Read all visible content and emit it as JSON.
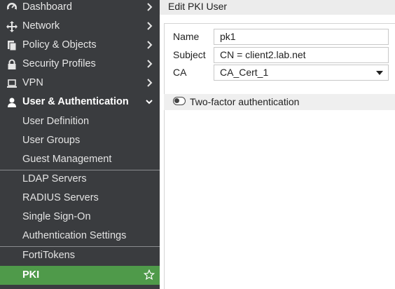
{
  "sidebar": {
    "items": [
      {
        "label": "Dashboard",
        "icon": "dashboard-icon"
      },
      {
        "label": "Network",
        "icon": "network-icon"
      },
      {
        "label": "Policy & Objects",
        "icon": "policy-icon"
      },
      {
        "label": "Security Profiles",
        "icon": "lock-icon"
      },
      {
        "label": "VPN",
        "icon": "laptop-icon"
      },
      {
        "label": "User & Authentication",
        "icon": "user-icon"
      }
    ],
    "subitems": [
      {
        "label": "User Definition"
      },
      {
        "label": "User Groups"
      },
      {
        "label": "Guest Management"
      },
      {
        "label": "LDAP Servers"
      },
      {
        "label": "RADIUS Servers"
      },
      {
        "label": "Single Sign-On"
      },
      {
        "label": "Authentication Settings"
      },
      {
        "label": "FortiTokens"
      },
      {
        "label": "PKI"
      }
    ],
    "selected": "PKI"
  },
  "header": {
    "title": "Edit PKI User"
  },
  "form": {
    "name_label": "Name",
    "name_value": "pk1",
    "subject_label": "Subject",
    "subject_value": "CN = client2.lab.net",
    "ca_label": "CA",
    "ca_value": "CA_Cert_1",
    "two_factor_label": "Two-factor authentication",
    "two_factor_enabled": false
  },
  "colors": {
    "sidebar_bg": "#3a3c3f",
    "selected_bg": "#4f9a4a"
  }
}
